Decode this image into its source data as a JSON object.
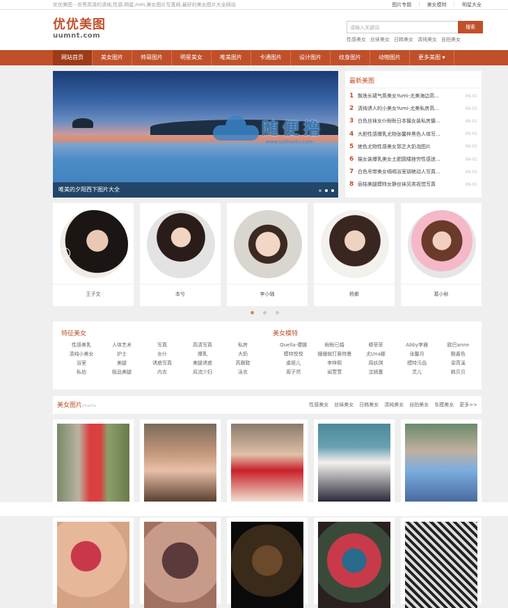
{
  "topbar": {
    "tagline": "优优美图 - 优秀高清的清纯,性感,明星,mm,美女图片写真网,最好的美女图片大全网站",
    "links": [
      "图片专题",
      "美女模特",
      "明星大全"
    ]
  },
  "header": {
    "logo_cn": "优优美图",
    "logo_en": "uumnt.com",
    "search_placeholder": "请输入关键词",
    "search_button": "搜索",
    "hot_words": [
      "性感美女",
      "丝袜美女",
      "日韩美女",
      "清纯美女",
      "自拍美女"
    ]
  },
  "nav": {
    "items": [
      "网站首页",
      "美女图片",
      "帅哥图片",
      "明星美女",
      "唯美图片",
      "卡通图片",
      "设计图片",
      "纹身图片",
      "动物图片",
      "更多美图 ▾"
    ]
  },
  "slider": {
    "caption": "唯美的夕阳西下图片大全"
  },
  "watermark": {
    "text": "随便撸",
    "sub": "www.suibianlu.com"
  },
  "newest": {
    "title": "最新美图",
    "items": [
      {
        "num": "1",
        "text": "飘逸长裙气质美女Yumi-尤美海边高...",
        "date": "06-01"
      },
      {
        "num": "2",
        "text": "清纯诱人的小美女Yumi-尤美私房高...",
        "date": "06-01"
      },
      {
        "num": "3",
        "text": "白色丝袜女仆盼盼日本猫女装私房摄...",
        "date": "06-01"
      },
      {
        "num": "4",
        "text": "大胆性感爆乳尤物张馨梓黑色人体写...",
        "date": "06-01"
      },
      {
        "num": "5",
        "text": "绝色尤物性感美女郭芷大奶泡图片",
        "date": "06-01"
      },
      {
        "num": "6",
        "text": "猫女装爆乳美女土肥圆矮挫穷性感迷...",
        "date": "06-01"
      },
      {
        "num": "7",
        "text": "白色吊带美女嗝嗝浴室胡艳动人写真...",
        "date": "06-01"
      },
      {
        "num": "8",
        "text": "丽桔美腿模特女静丝袜另类视觉写真",
        "date": "06-01"
      }
    ]
  },
  "stars": {
    "names": [
      "王子文",
      "本兮",
      "李小璐",
      "杨紫",
      "葛小秋"
    ]
  },
  "tags": {
    "left_title": "特征美女",
    "left": [
      "性感美乳",
      "人体艺术",
      "写真",
      "高清写真",
      "私房",
      "清纯小美女",
      "护士",
      "女仆",
      "爆乳",
      "大奶",
      "浴室",
      "美腿",
      "诱惑写真",
      "美腿诱惑",
      "高跟鞋",
      "私拍",
      "极品美腿",
      "内衣",
      "风流少妇",
      "泳衣"
    ],
    "right_title": "美女模特",
    "right": [
      "Quella-瓔娜",
      "盼盼已婚",
      "穆菲菲",
      "Abby李雅",
      "欧巴anne",
      "模特悦悦",
      "姗姗就打奥特曼",
      "尤Una娜",
      "张馨月",
      "酸酱色",
      "虞姬儿",
      "李梓熙",
      "周玖琪",
      "模特污品",
      "梁芮溪",
      "周子然",
      "闻萱萱",
      "沈嫣蔓",
      "灵儿",
      "韩贝贝"
    ]
  },
  "section": {
    "title": "美女图片",
    "subtitle": "/meinv",
    "links": [
      "性感美女",
      "丝袜美女",
      "日韩美女",
      "清纯美女",
      "自拍美女",
      "车模美女",
      "更多>>"
    ]
  },
  "colors": {
    "accent": "#c0502a",
    "nav_active": "#9e3a17",
    "background": "#efefef"
  }
}
